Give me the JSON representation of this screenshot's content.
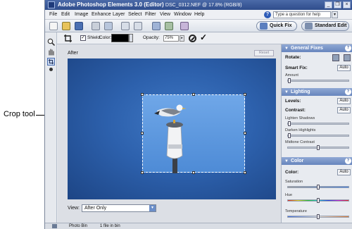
{
  "callout": {
    "label": "Crop tool"
  },
  "window": {
    "title": "Adobe Photoshop Elements 3.0 (Editor)",
    "subtitle": "DSC_0312.NEF @ 17.8% (RGB/8)",
    "buttons": {
      "minimize": "_",
      "restore": "❐",
      "close": "×"
    }
  },
  "menu": {
    "items": [
      "File",
      "Edit",
      "Image",
      "Enhance",
      "Layer",
      "Select",
      "Filter",
      "View",
      "Window",
      "Help"
    ],
    "help_placeholder": "Type a question for help",
    "help_arrow": "▾"
  },
  "modes": {
    "quick_fix": "Quick Fix",
    "standard_edit": "Standard Edit"
  },
  "options": {
    "shield_checked": "✓",
    "shield_label": "Shield",
    "color_label": "Color:",
    "opacity_label": "Opacity:",
    "opacity_value": "75%",
    "opacity_arrow": "▸",
    "commit_glyph": "✓"
  },
  "canvas": {
    "after_label": "After",
    "reset_label": "Reset",
    "view_label": "View:",
    "view_value": "After Only",
    "view_arrow": "▾"
  },
  "palette": {
    "general_fixes": {
      "title": "General Fixes",
      "rotate_label": "Rotate:",
      "smart_fix_label": "Smart Fix:",
      "smart_fix_auto": "Auto",
      "amount_label": "Amount"
    },
    "lighting": {
      "title": "Lighting",
      "levels_label": "Levels:",
      "levels_auto": "Auto",
      "contrast_label": "Contrast:",
      "contrast_auto": "Auto",
      "lighten_shadows": "Lighten Shadows",
      "darken_highlights": "Darken Highlights",
      "midtone_contrast": "Midtone Contrast"
    },
    "color": {
      "title": "Color",
      "color_label": "Color:",
      "color_auto": "Auto",
      "saturation": "Saturation",
      "hue": "Hue",
      "temperature": "Temperature"
    },
    "sliders": {
      "amount": 0.0,
      "lighten_shadows": 0.0,
      "darken_highlights": 0.0,
      "midtone_contrast": 0.5,
      "saturation": 0.5,
      "hue": 0.5,
      "temperature": 0.5
    }
  },
  "status": {
    "photo_bin": "Photo Bin",
    "bin_count": "1 file in bin"
  },
  "colors": {
    "accent": "#2f4d8c",
    "sky": "#2d61ad",
    "crop_fill": "#5b96dd"
  },
  "icons": [
    "zoom-icon",
    "hand-icon",
    "crop-icon",
    "cancel-icon",
    "commit-icon",
    "help-icon",
    "rotate-left-icon",
    "rotate-right-icon"
  ]
}
